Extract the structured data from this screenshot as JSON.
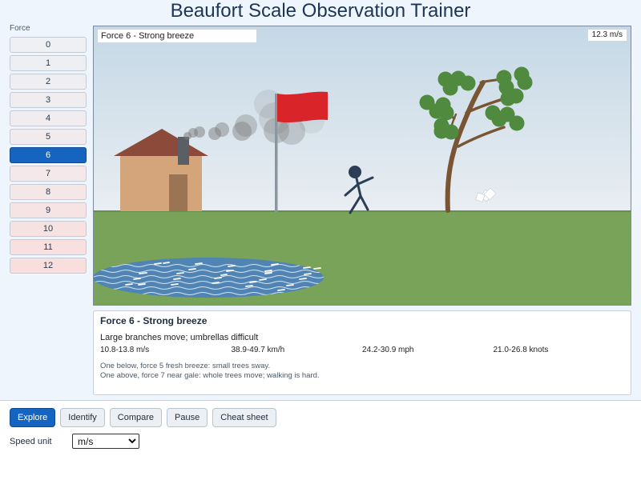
{
  "app": {
    "title": "Beaufort Scale Observation Trainer"
  },
  "sidebar": {
    "label": "Force",
    "items": [
      {
        "label": "0",
        "color": "#eef0f4"
      },
      {
        "label": "1",
        "color": "#eeeff3"
      },
      {
        "label": "2",
        "color": "#efeef2"
      },
      {
        "label": "3",
        "color": "#f0edf1"
      },
      {
        "label": "4",
        "color": "#f1ecf0"
      },
      {
        "label": "5",
        "color": "#f2ebee"
      },
      {
        "label": "6",
        "color": "#1565c0"
      },
      {
        "label": "7",
        "color": "#f4e8ea"
      },
      {
        "label": "8",
        "color": "#f5e6e8"
      },
      {
        "label": "9",
        "color": "#f6e4e5"
      },
      {
        "label": "10",
        "color": "#f7e2e2"
      },
      {
        "label": "11",
        "color": "#f8e0e0"
      },
      {
        "label": "12",
        "color": "#f9dede"
      }
    ],
    "selected_index": 6
  },
  "scene": {
    "label": "Force 6 - Strong breeze",
    "speed": "12.3 m/s"
  },
  "info": {
    "title": "Force 6 - Strong breeze",
    "description": "Large branches move; umbrellas difficult",
    "units": [
      "10.8-13.8 m/s",
      "38.9-49.7 km/h",
      "24.2-30.9 mph",
      "21.0-26.8 knots"
    ],
    "below": "One below, force 5 fresh breeze: small trees sway.",
    "above": "One above, force 7 near gale: whole trees move; walking is hard."
  },
  "modes": {
    "items": [
      {
        "label": "Explore",
        "active": true
      },
      {
        "label": "Identify",
        "active": false
      },
      {
        "label": "Compare",
        "active": false
      },
      {
        "label": "Pause",
        "active": false
      },
      {
        "label": "Cheat sheet",
        "active": false
      }
    ]
  },
  "settings": {
    "speed_unit_label": "Speed unit",
    "speed_unit_value": "m/s",
    "speed_unit_options": [
      "m/s"
    ]
  },
  "colors": {
    "accent": "#1565c0",
    "sky_top": "#c7d9e6",
    "grass": "#7aa35a",
    "flag": "#d9252a",
    "house_wall": "#d4a57b",
    "roof": "#8b4a3a",
    "pond": "#4f84b4",
    "tree_leaves": "#4f8a3f"
  }
}
